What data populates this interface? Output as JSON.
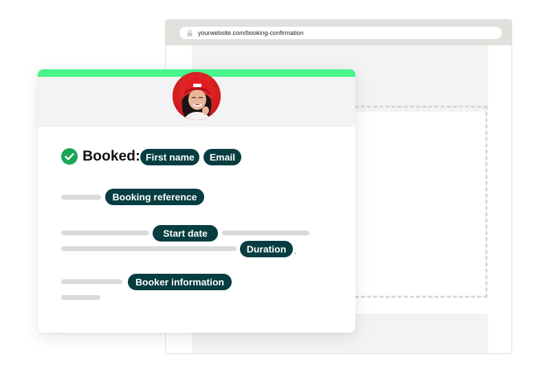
{
  "browser": {
    "url": "yourwebsite.com/booking-confirmation",
    "lock_icon": "lock-icon"
  },
  "card": {
    "accent_color": "#47f58a",
    "avatar_icon": "user-avatar",
    "check_icon": "check-circle-icon",
    "booked_label": "Booked:",
    "tags": {
      "first_name": "First name",
      "email": "Email",
      "booking_reference": "Booking reference",
      "start_date": "Start date",
      "duration": "Duration",
      "booker_information": "Booker information"
    },
    "duration_suffix": "."
  },
  "colors": {
    "tag_bg": "#073d40",
    "check": "#1aa654",
    "placeholder_bar": "#d8dbd7"
  }
}
